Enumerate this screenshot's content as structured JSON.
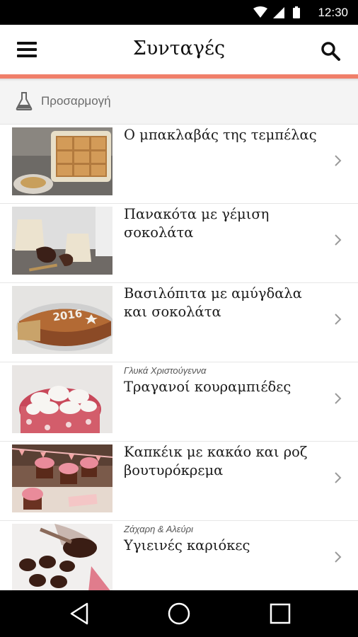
{
  "status_bar": {
    "time": "12:30",
    "icons": [
      "wifi-icon",
      "signal-icon",
      "battery-icon"
    ]
  },
  "app_bar": {
    "title": "Συνταγές",
    "menu_icon": "hamburger-menu-icon",
    "search_icon": "search-icon"
  },
  "colors": {
    "accent": "#f07f6a",
    "filter_background": "#f4f4f4",
    "text": "#1b1b1b"
  },
  "filter": {
    "icon": "flask-icon",
    "label": "Προσαρμογή"
  },
  "recipes": [
    {
      "category": "",
      "title": "Ο μπακλαβάς της τεμπέλας"
    },
    {
      "category": "",
      "title": "Πανακότα με γέμιση σοκολάτα"
    },
    {
      "category": "",
      "title": "Βασιλόπιτα με αμύγδαλα και σοκολάτα",
      "cake_text": "2016"
    },
    {
      "category": "Γλυκά Χριστούγεννα",
      "title": "Τραγανοί κουραμπιέδες"
    },
    {
      "category": "",
      "title": "Καπκέικ με κακάο και ροζ βουτυρόκρεμα"
    },
    {
      "category": "Ζάχαρη & Αλεύρι",
      "title": "Υγιεινές καριόκες"
    }
  ],
  "nav_bar": {
    "buttons": [
      "back-icon",
      "home-icon",
      "recents-icon"
    ]
  }
}
